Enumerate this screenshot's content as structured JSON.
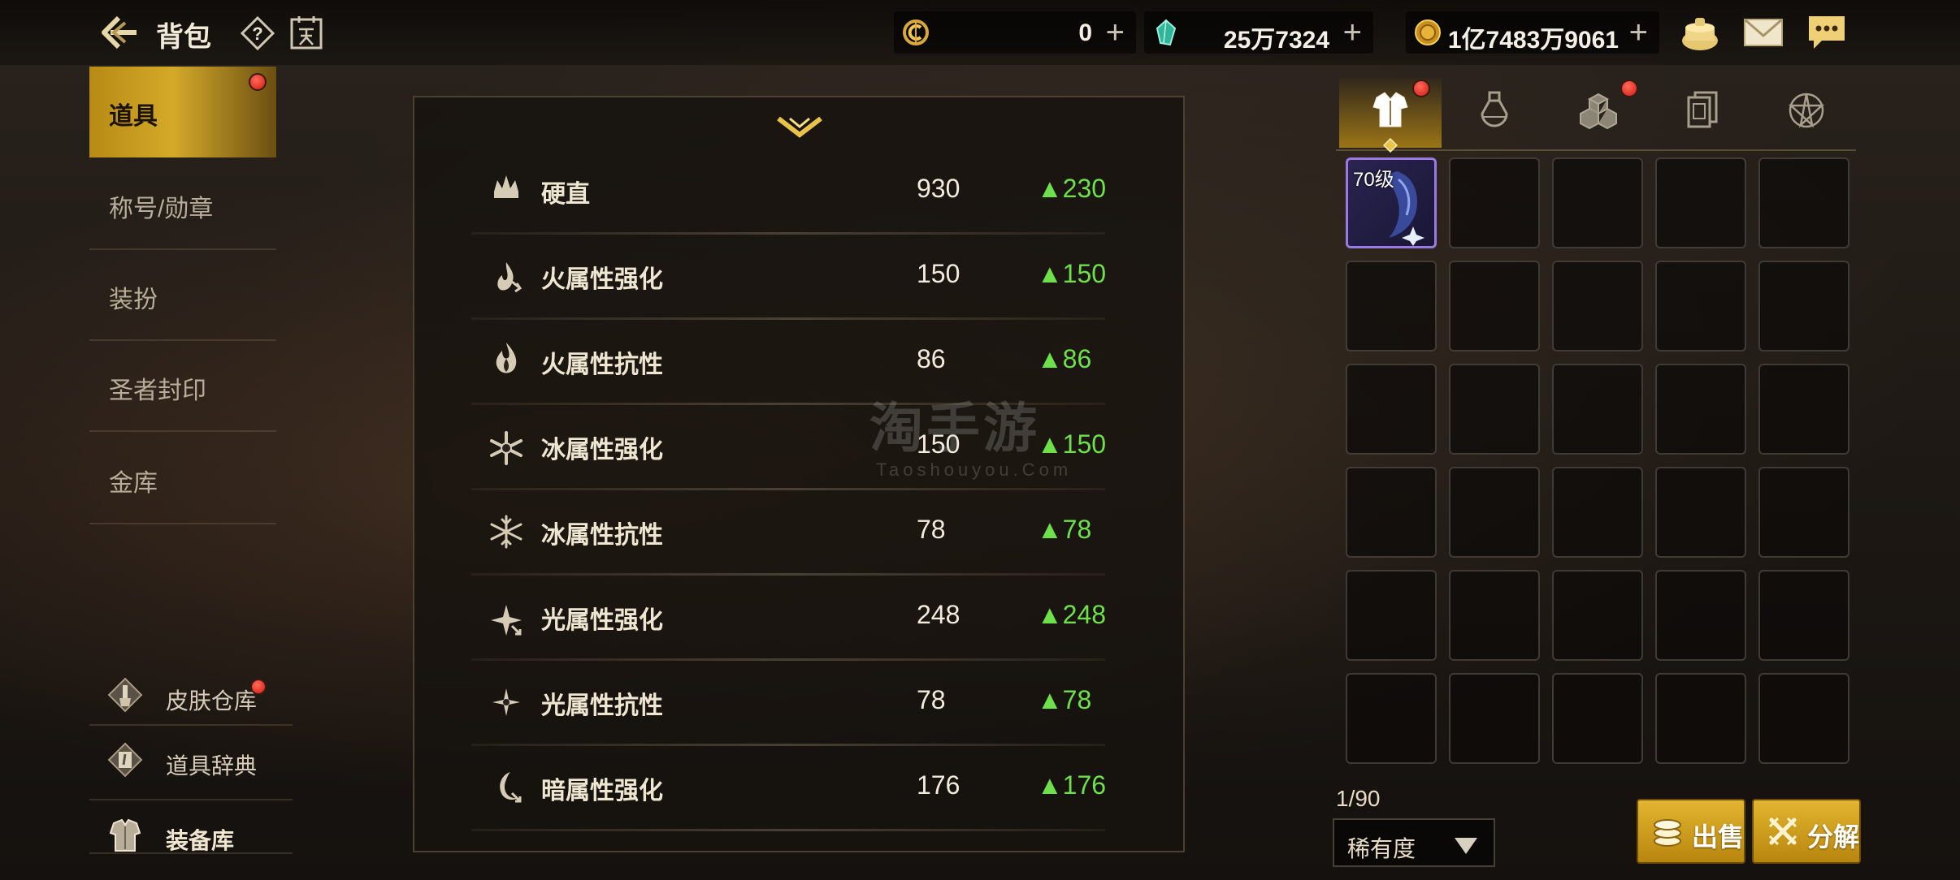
{
  "header": {
    "title": "背包"
  },
  "currencies": [
    {
      "icon": "c-coin-icon",
      "value": "0"
    },
    {
      "icon": "green-crystal-icon",
      "value": "25万7324"
    },
    {
      "icon": "gold-coin-icon",
      "value": "1亿7483万9061"
    }
  ],
  "sidebar": {
    "items": [
      {
        "label": "道具",
        "active": true,
        "badge": true
      },
      {
        "label": "称号/勋章"
      },
      {
        "label": "装扮"
      },
      {
        "label": "圣者封印"
      },
      {
        "label": "金库"
      }
    ],
    "sub_items": [
      {
        "label": "皮肤仓库",
        "icon": "brush-icon",
        "badge": true
      },
      {
        "label": "道具辞典",
        "icon": "book-icon"
      },
      {
        "label": "装备库",
        "icon": "armor-icon"
      }
    ]
  },
  "stats": [
    {
      "name": "硬直",
      "value": "930",
      "increase": "▲230",
      "icon": "stagger-icon"
    },
    {
      "name": "火属性强化",
      "value": "150",
      "increase": "▲150",
      "icon": "fire-enhance-icon"
    },
    {
      "name": "火属性抗性",
      "value": "86",
      "increase": "▲86",
      "icon": "fire-resist-icon"
    },
    {
      "name": "冰属性强化",
      "value": "150",
      "increase": "▲150",
      "icon": "ice-enhance-icon"
    },
    {
      "name": "冰属性抗性",
      "value": "78",
      "increase": "▲78",
      "icon": "ice-resist-icon"
    },
    {
      "name": "光属性强化",
      "value": "248",
      "increase": "▲248",
      "icon": "light-enhance-icon"
    },
    {
      "name": "光属性抗性",
      "value": "78",
      "increase": "▲78",
      "icon": "light-resist-icon"
    },
    {
      "name": "暗属性强化",
      "value": "176",
      "increase": "▲176",
      "icon": "dark-enhance-icon"
    }
  ],
  "inventory": {
    "tabs": [
      {
        "icon": "armor-tab-icon",
        "active": true,
        "badge": true
      },
      {
        "icon": "potion-tab-icon"
      },
      {
        "icon": "materials-tab-icon",
        "badge": true
      },
      {
        "icon": "cards-tab-icon"
      },
      {
        "icon": "pentagram-tab-icon"
      }
    ],
    "first_item_level": "70级",
    "capacity": "1/90",
    "sort_label": "稀有度",
    "sell_label": "出售",
    "disassemble_label": "分解"
  },
  "watermark": {
    "main": "淘手游",
    "sub": "Taoshouyou.Com"
  },
  "colors": {
    "gold": "#d4a929",
    "green": "#6ee04a",
    "badge": "#d01a10",
    "rare_border": "#9a7ae0"
  }
}
